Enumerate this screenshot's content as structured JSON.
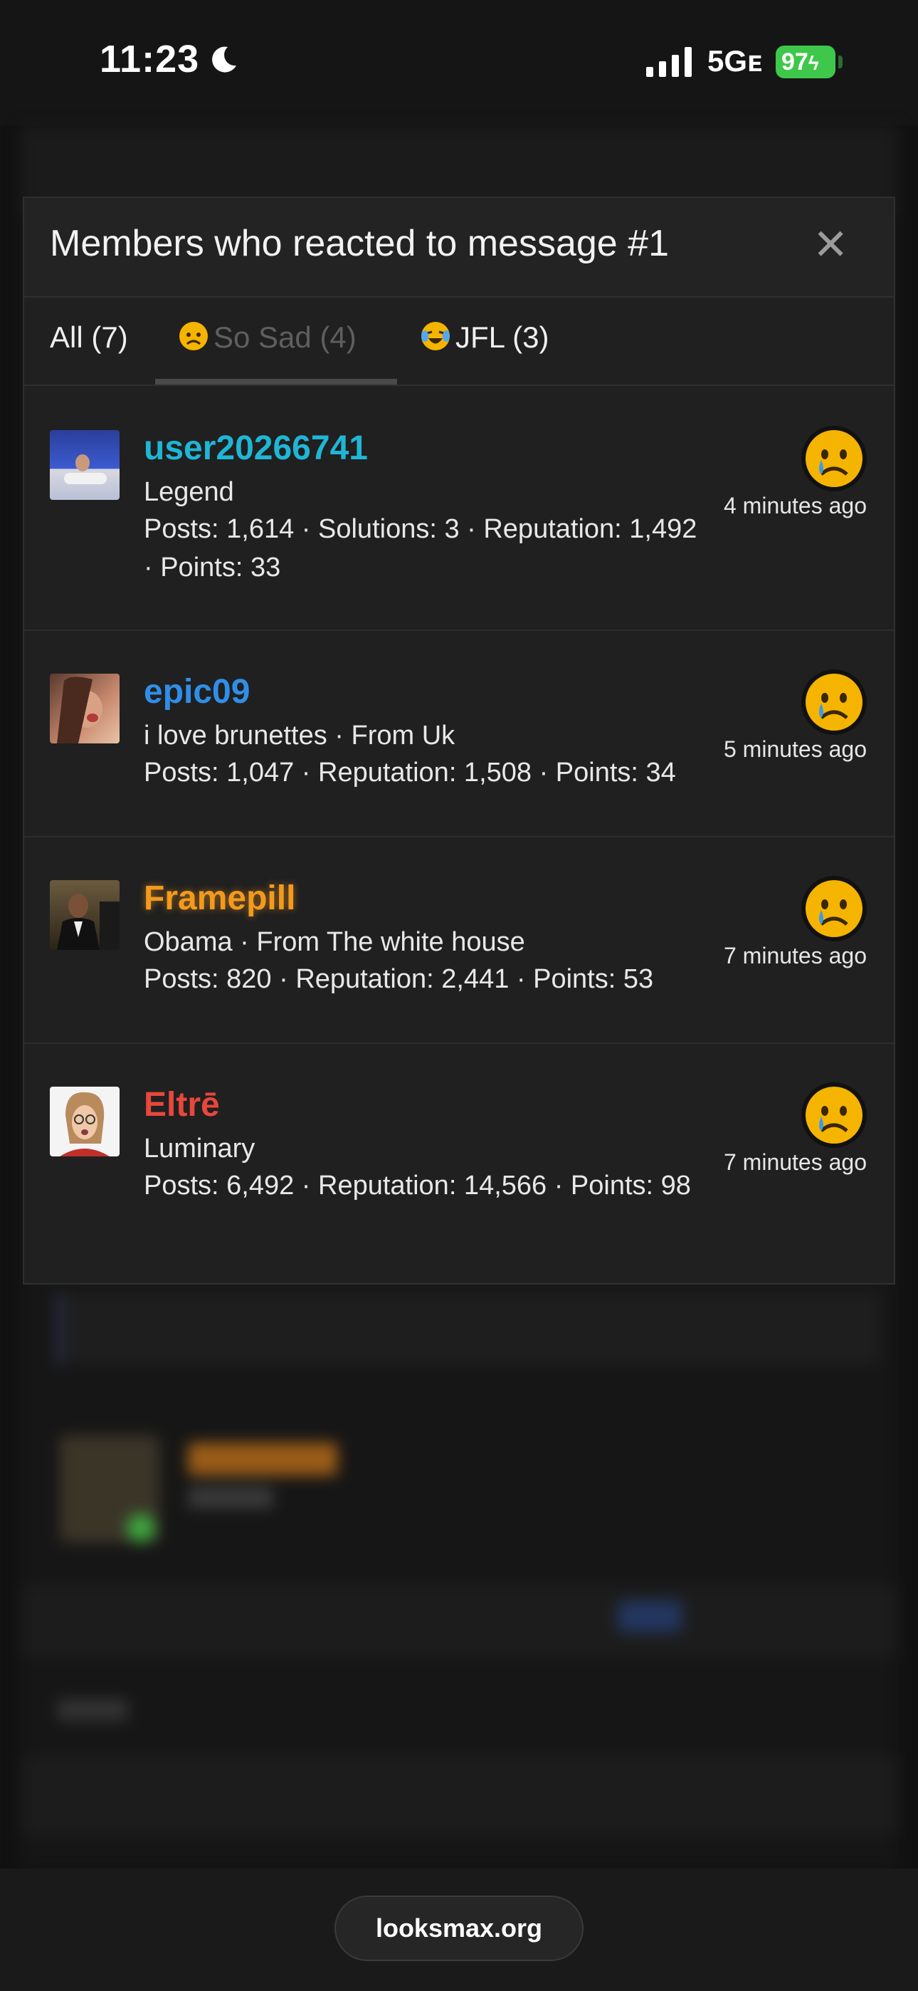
{
  "status_bar": {
    "time": "11:23",
    "network": "5Gᴇ",
    "battery": "97"
  },
  "modal": {
    "title": "Members who reacted to message #1",
    "tabs": [
      {
        "label": "All (7)",
        "active": false
      },
      {
        "label": "So Sad (4)",
        "active": true
      },
      {
        "label": "JFL (3)",
        "active": false
      }
    ],
    "members": [
      {
        "name": "user20266741",
        "name_color": "#1fb6d6",
        "title": "Legend",
        "stats": "Posts: 1,614 · Solutions: 3 · Reputation: 1,492 · Points: 33",
        "time": "4 minutes ago"
      },
      {
        "name": "epic09",
        "name_color": "#2f8fe8",
        "title": "i love brunettes · From Uk",
        "stats": "Posts: 1,047 · Reputation: 1,508 · Points: 34",
        "time": "5 minutes ago"
      },
      {
        "name": "Framepill",
        "name_color": "#f39a1e",
        "title": "Obama · From The white house",
        "stats": "Posts: 820 · Reputation: 2,441 · Points: 53",
        "time": "7 minutes ago"
      },
      {
        "name": "Eltrē",
        "name_color": "#e8473b",
        "title": "Luminary",
        "stats": "Posts: 6,492 · Reputation: 14,566 · Points: 98",
        "time": "7 minutes ago"
      }
    ]
  },
  "browser": {
    "url": "looksmax.org"
  },
  "colors": {
    "background": "#111112",
    "modal": "#202020",
    "battery": "#3ec74a"
  }
}
